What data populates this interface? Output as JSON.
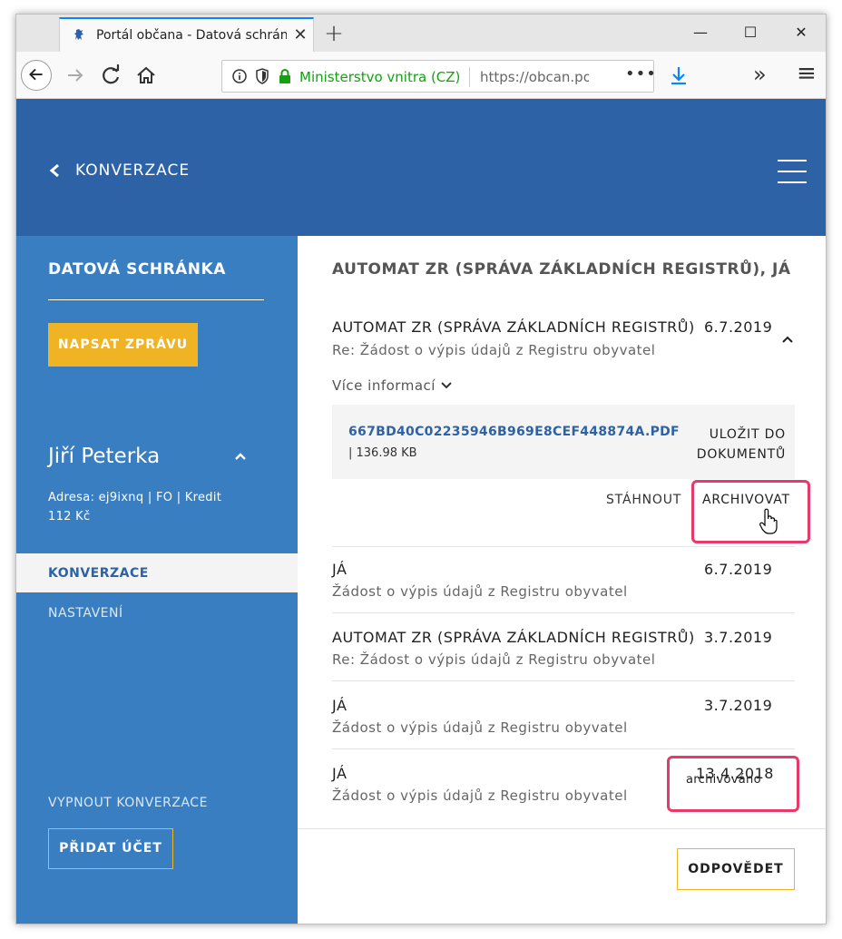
{
  "browser": {
    "tab_title": "Portál občana - Datová schránka",
    "tab_close": "✕",
    "new_tab": "+",
    "url_org": "Ministerstvo vnitra (CZ)",
    "url_text": "https://obcan.portal.gov.cz",
    "url_more": "•••",
    "win_minimize": "—",
    "win_maximize": "☐",
    "win_close": "✕",
    "overflow": "»",
    "menu": "≡"
  },
  "header": {
    "back_label": "KONVERZACE"
  },
  "sidebar": {
    "title": "DATOVÁ SCHRÁNKA",
    "write_button": "NAPSAT ZPRÁVU",
    "user_name": "Jiří Peterka",
    "address_line1": "Adresa: ej9ixnq | FO | Kredit",
    "address_line2": "112 Kč",
    "nav_active": "KONVERZACE",
    "nav_settings": "NASTAVENÍ",
    "turn_off": "VYPNOUT KONVERZACE",
    "add_account": "PŘIDAT ÚČET"
  },
  "main": {
    "title": "AUTOMAT ZR (SPRÁVA ZÁKLADNÍCH REGISTRŮ), JÁ",
    "messages": [
      {
        "sender": "AUTOMAT ZR (SPRÁVA ZÁKLADNÍCH REGISTRŮ)",
        "subject": "Re: Žádost o výpis údajů z Registru obyvatel",
        "date": "6.7.2019"
      },
      {
        "sender": "JÁ",
        "subject": "Žádost o výpis údajů z Registru obyvatel",
        "date": "6.7.2019"
      },
      {
        "sender": "AUTOMAT ZR (SPRÁVA ZÁKLADNÍCH REGISTRŮ)",
        "subject": "Re: Žádost o výpis údajů z Registru obyvatel",
        "date": "3.7.2019"
      },
      {
        "sender": "JÁ",
        "subject": "Žádost o výpis údajů z Registru obyvatel",
        "date": "3.7.2019"
      },
      {
        "sender": "JÁ",
        "subject": "Žádost o výpis údajů z Registru obyvatel",
        "date": "13.4.2018",
        "status": "archivováno"
      }
    ],
    "more_info": "Více informací",
    "attachment": {
      "name": "667BD40C02235946B969E8CEF448874A.PDF",
      "size": "| 136.98 KB",
      "save_label": "ULOŽIT DO DOKUMENTŮ"
    },
    "download_label": "STÁHNOUT",
    "archive_label": "ARCHIVOVAT",
    "reply_button": "ODPOVĚDET"
  },
  "colors": {
    "brand_blue": "#2e62a6",
    "sidebar_blue": "#3a7ec2",
    "accent_yellow": "#f0b323",
    "highlight": "#e63a6a"
  }
}
